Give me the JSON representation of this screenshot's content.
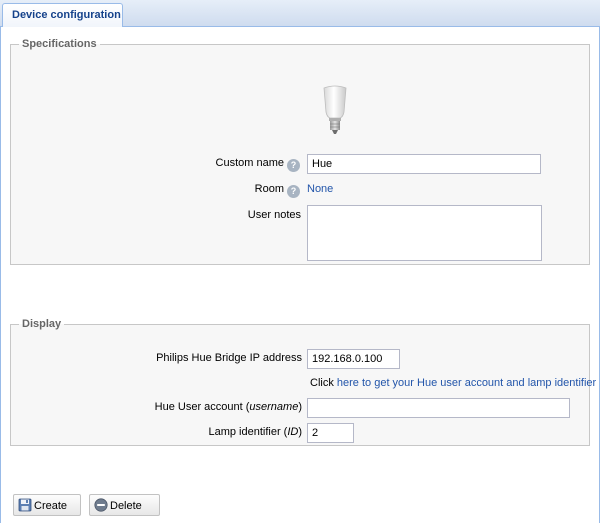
{
  "tab": {
    "label": "Device configuration"
  },
  "specifications": {
    "legend": "Specifications",
    "custom_name_label": "Custom name",
    "custom_name_value": "Hue",
    "room_label": "Room",
    "room_value": "None",
    "user_notes_label": "User notes",
    "user_notes_value": "",
    "help_glyph": "?"
  },
  "display": {
    "legend": "Display",
    "bridge_ip_label": "Philips Hue Bridge IP address",
    "bridge_ip_value": "192.168.0.100",
    "click_prefix": "Click",
    "click_link": "here to get your Hue user account and lamp identifier",
    "user_account_label_prefix": "Hue User account (",
    "user_account_label_em": "username",
    "user_account_label_suffix": ")",
    "user_account_value": "",
    "lamp_id_label_prefix": "Lamp identifier (",
    "lamp_id_label_em": "ID",
    "lamp_id_label_suffix": ")",
    "lamp_id_value": "2"
  },
  "buttons": {
    "create_label": "Create",
    "delete_label": "Delete"
  },
  "icons": {
    "device_image": "hue-bulb-icon",
    "help": "help-icon",
    "create": "save-icon",
    "delete": "minus-circle-icon"
  },
  "colors": {
    "tab_text": "#15428b",
    "link": "#2255aa",
    "legend": "#666666",
    "fieldset_bg": "#f7f7f7"
  }
}
